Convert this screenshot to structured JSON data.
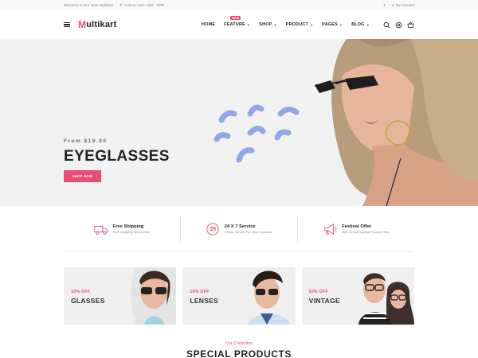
{
  "topbar": {
    "welcome": "Welcome to Our store Multikart",
    "phone": "Call Us: 123 - 456 - 7890",
    "account": "My Account"
  },
  "header": {
    "logo_mark": "M",
    "logo_text": "ultikart",
    "nav": [
      {
        "label": "HOME"
      },
      {
        "label": "FEATURE",
        "badge": "NEW"
      },
      {
        "label": "SHOP"
      },
      {
        "label": "PRODUCT"
      },
      {
        "label": "PAGES"
      },
      {
        "label": "BLOG"
      }
    ]
  },
  "hero": {
    "subtitle": "From $19.00",
    "title": "EYEGLASSES",
    "cta": "SHOP NOW"
  },
  "services": [
    {
      "icon": "truck-icon",
      "title": "Free Shipping",
      "desc": "Free Shipping World Wide"
    },
    {
      "icon": "clock-24-icon",
      "title": "24 X 7 Service",
      "desc": "Online Service For New Customer"
    },
    {
      "icon": "megaphone-icon",
      "title": "Festival Offer",
      "desc": "New Online Special Festival Offer"
    }
  ],
  "banners": [
    {
      "discount": "10% OFF",
      "name": "GLASSES"
    },
    {
      "discount": "10% OFF",
      "name": "LENSES"
    },
    {
      "discount": "50% OFF",
      "name": "VINTAGE"
    }
  ],
  "collection": {
    "eyebrow": "Our Collection",
    "heading": "SPECIAL PRODUCTS"
  },
  "colors": {
    "accent": "#ec4c71",
    "shapes": "#8fa8e8",
    "hero_bg": "#f2f2f2"
  }
}
